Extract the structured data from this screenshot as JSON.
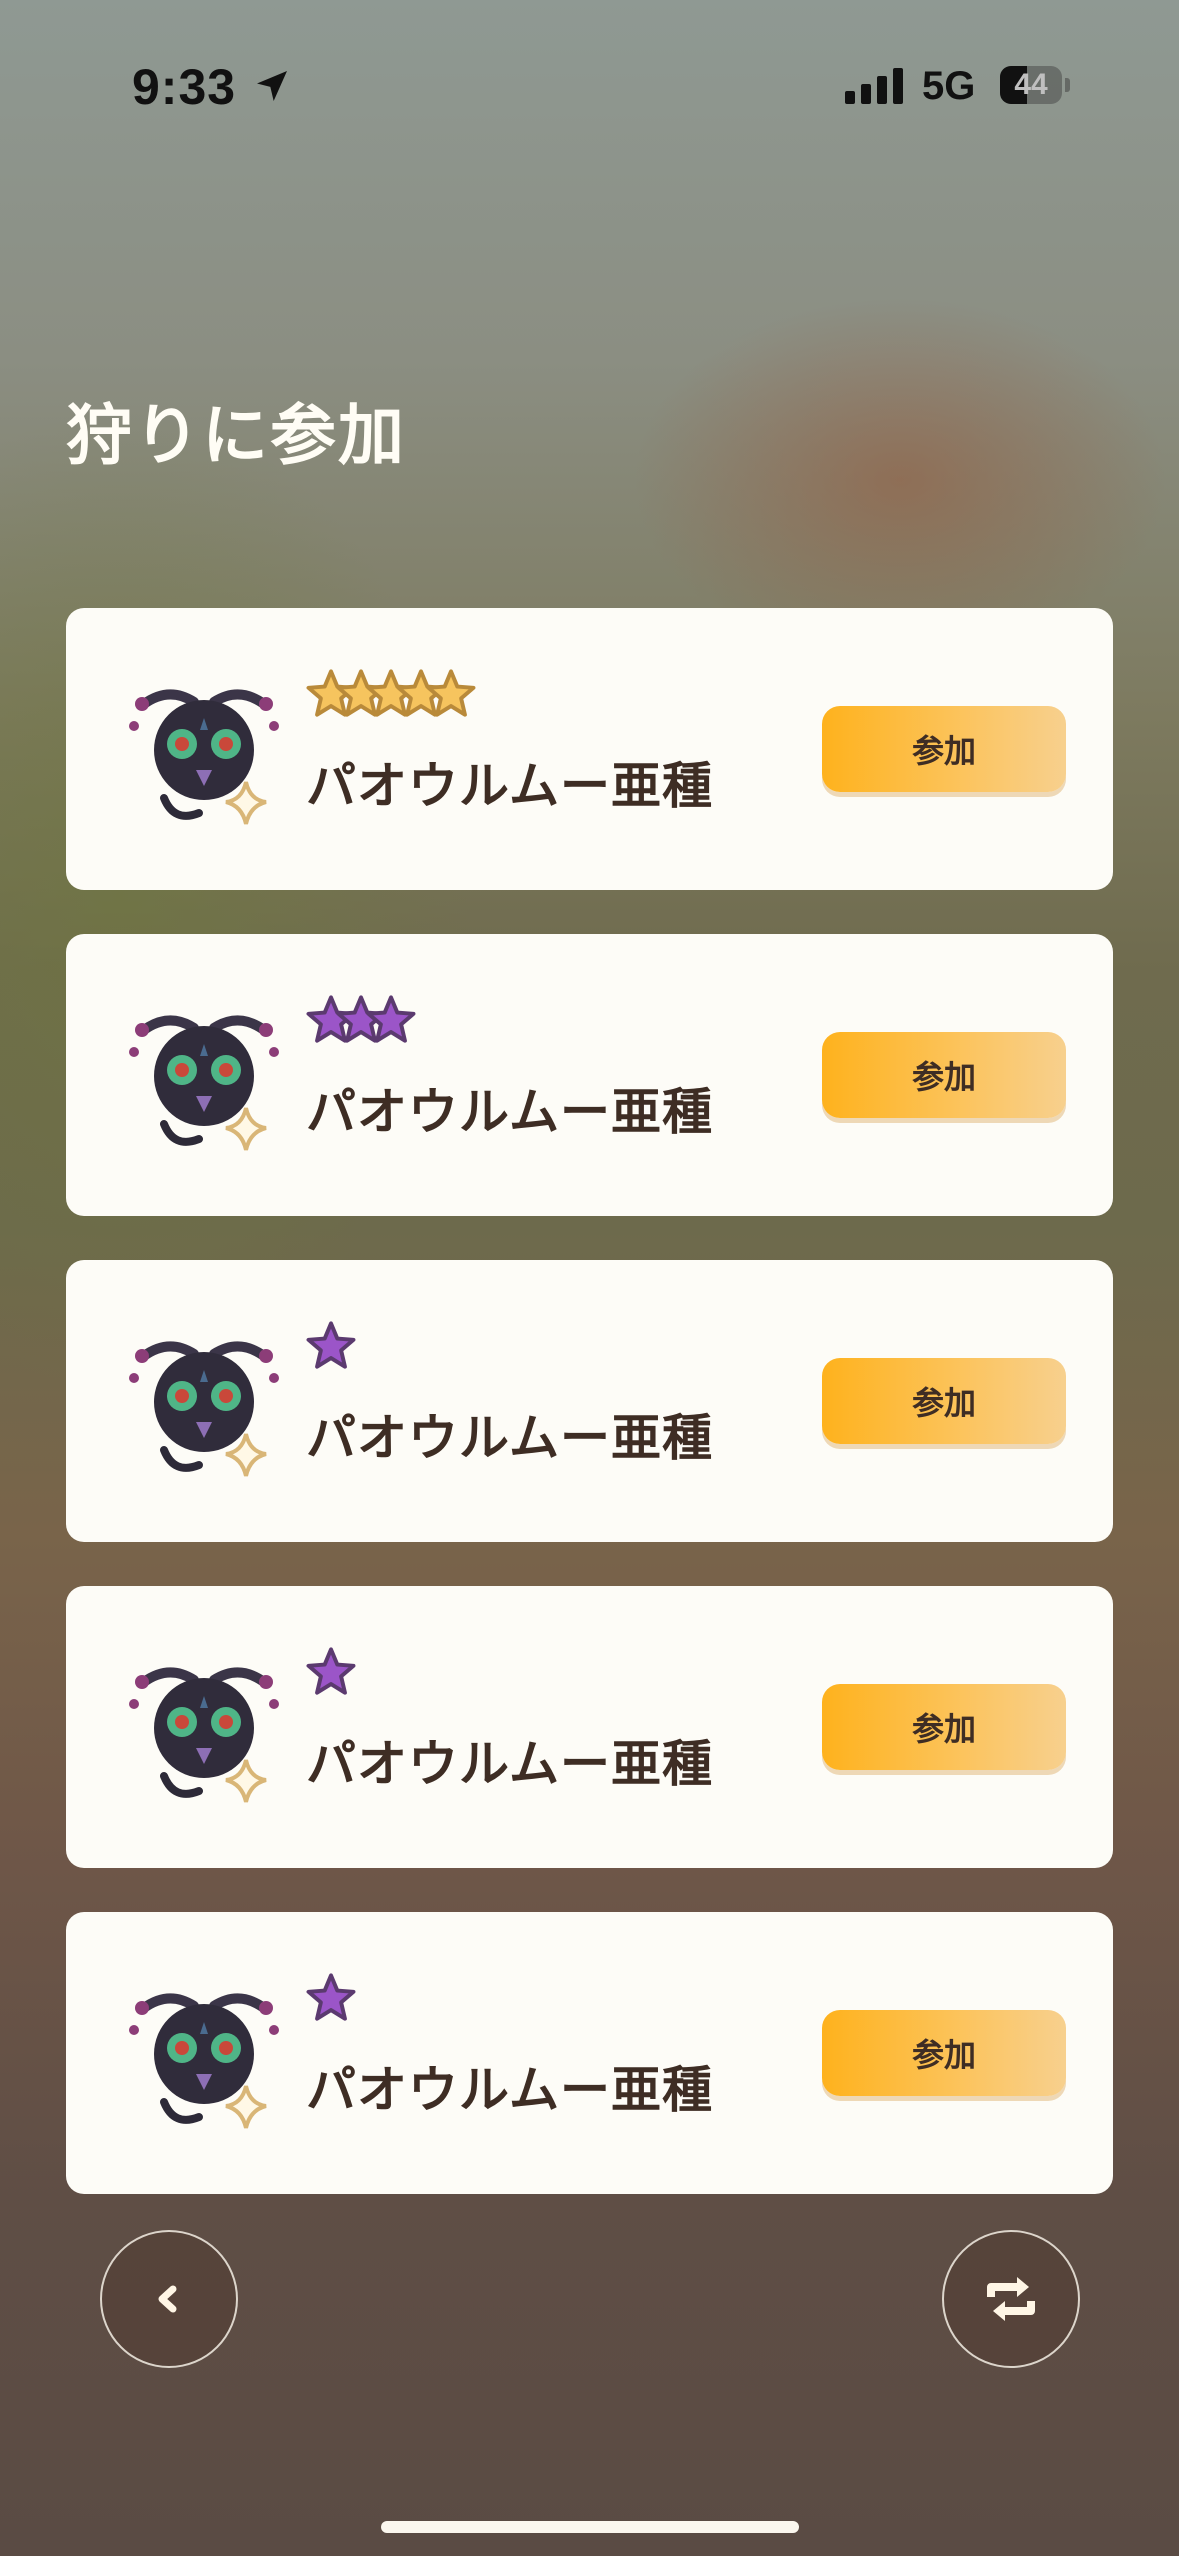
{
  "status_bar": {
    "time": "9:33",
    "network": "5G",
    "battery": 44
  },
  "page": {
    "title": "狩りに参加"
  },
  "hunts": [
    {
      "name": "パオウルムー亜種",
      "stars": 5,
      "star_color": "gold",
      "button": "参加"
    },
    {
      "name": "パオウルムー亜種",
      "stars": 3,
      "star_color": "purple",
      "button": "参加"
    },
    {
      "name": "パオウルムー亜種",
      "stars": 1,
      "star_color": "purple",
      "button": "参加"
    },
    {
      "name": "パオウルムー亜種",
      "stars": 1,
      "star_color": "purple",
      "button": "参加"
    },
    {
      "name": "パオウルムー亜種",
      "stars": 1,
      "star_color": "purple",
      "button": "参加"
    }
  ],
  "icons": {
    "back": "chevron-left-icon",
    "refresh": "refresh-icon",
    "location": "location-arrow-icon"
  },
  "colors": {
    "gold_star": "#f6c45e",
    "purple_star": "#9b55c8",
    "button": "#feb21d",
    "text": "#3e2d24"
  }
}
